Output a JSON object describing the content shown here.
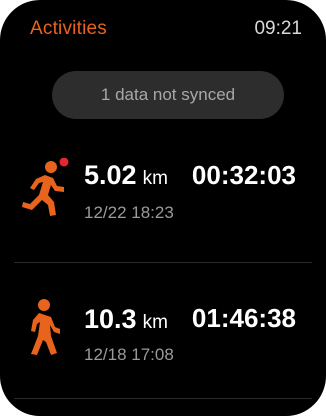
{
  "header": {
    "title": "Activities",
    "time": "09:21"
  },
  "sync_banner": {
    "text": "1 data not synced"
  },
  "activities": [
    {
      "icon": "running-icon",
      "distance": "5.02",
      "unit": "km",
      "duration": "00:32:03",
      "datetime": "12/22 18:23",
      "unsynced": true
    },
    {
      "icon": "walking-icon",
      "distance": "10.3",
      "unit": "km",
      "duration": "01:46:38",
      "datetime": "12/18 17:08",
      "unsynced": false
    }
  ],
  "colors": {
    "accent": "#e8631c",
    "unsynced_indicator": "#e3262f",
    "background": "#000000"
  }
}
